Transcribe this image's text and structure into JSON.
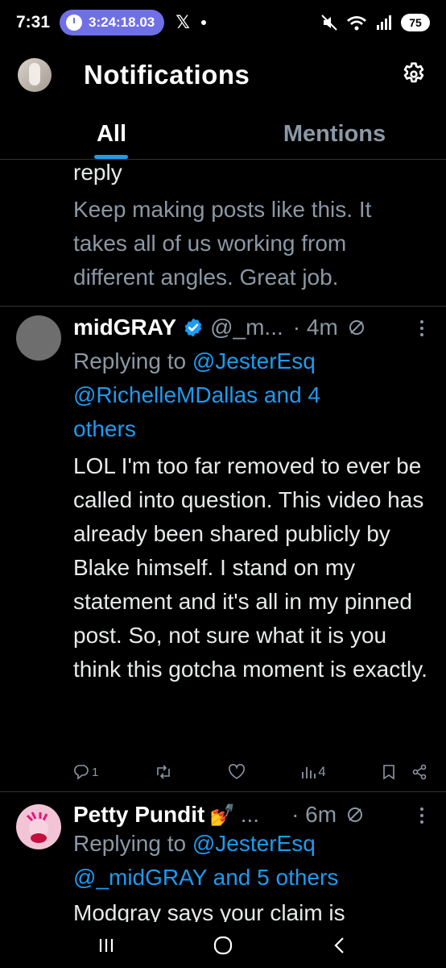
{
  "status_bar": {
    "time": "7:31",
    "timer": "3:24:18.03",
    "x_label": "𝕏",
    "battery": "75",
    "icons": [
      "mute-icon",
      "wifi-icon",
      "signal-icon",
      "battery-icon"
    ]
  },
  "header": {
    "title": "Notifications",
    "settings_icon": "gear-icon"
  },
  "tabs": [
    {
      "label": "All",
      "active": true
    },
    {
      "label": "Mentions",
      "active": false
    }
  ],
  "previous_post": {
    "reply_word": "reply",
    "body": "Keep making posts like this. It takes all of us working from different angles. Great job."
  },
  "posts": [
    {
      "name": "midGRAY",
      "handle": "@_m...",
      "time": "· 4m",
      "verified": true,
      "replying_prefix": "Replying to ",
      "replying_first": "@JesterEsq",
      "replying_second": "@RichelleMDallas and 4",
      "replying_third": "others",
      "body": "LOL I'm too far removed to ever be called into question. This video has already been shared publicly by Blake himself. I stand on my statement and it's all in my pinned post. So, not sure what it is you think this gotcha moment is exactly.",
      "reply_count": "1",
      "view_count": "4"
    },
    {
      "name": "Petty Pundit",
      "handle": "...",
      "time": "· 6m",
      "emoji": "💅",
      "replying_prefix": "Replying to ",
      "replying_first": "@JesterEsq",
      "replying_second": "@_midGRAY and 5 others",
      "body": "Modgray says your claim is"
    }
  ],
  "colors": {
    "background": "#000000",
    "accent": "#1d9bf0",
    "secondary_text": "#8b98a5",
    "primary_text": "#e7e9ea",
    "divider": "#2f3336"
  }
}
